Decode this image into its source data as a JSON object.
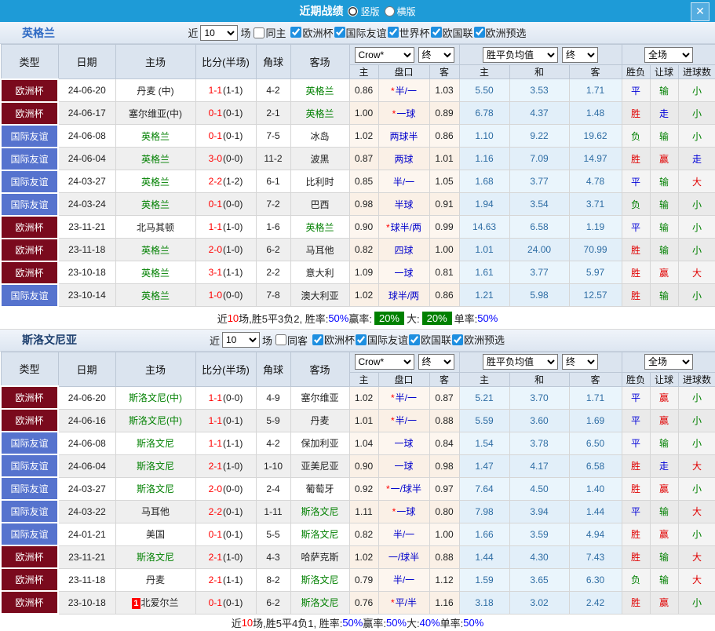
{
  "titlebar": {
    "title": "近期战绩",
    "radio_vertical": "竖版",
    "radio_horizontal": "横版",
    "close": "✕"
  },
  "filter_labels": {
    "near": "近",
    "count": "10",
    "games": "场"
  },
  "headers": {
    "type": "类型",
    "date": "日期",
    "home": "主场",
    "score": "比分(半场)",
    "corner": "角球",
    "away": "客场",
    "sub": [
      "主",
      "盘口",
      "客",
      "主",
      "和",
      "客",
      "胜负",
      "让球",
      "进球数"
    ],
    "dd_crow": "Crow*",
    "dd_final": "终",
    "dd_avg": "胜平负均值",
    "dd_full": "全场"
  },
  "league_colors": {
    "欧洲杯": "#7a0a1d",
    "国际友谊": "#5673ce"
  },
  "value_colors": {
    "胜": "#e00000",
    "平": "#0000d8",
    "负": "#008000",
    "赢": "#e00000",
    "走": "#0000d8",
    "输": "#008000",
    "大": "#e00000",
    "小": "#008000"
  },
  "colors": {
    "topbar": "#1e9bd7",
    "score": "#ff0000",
    "self_team": "#008000",
    "handicap": "#0000cc",
    "avg_text": "#2e6da4",
    "badge_bg": "#008000"
  },
  "sections": [
    {
      "team": "英格兰",
      "focal": "英格兰",
      "label_color": "#2e6ac4",
      "count": "10",
      "same_label": "同主",
      "leagues": [
        "欧洲杯",
        "国际友谊",
        "世界杯",
        "欧国联",
        "欧洲预选"
      ],
      "rows": [
        {
          "lg": "欧洲杯",
          "d": "24-06-20",
          "h": "丹麦 (中)",
          "ft": "1-1",
          "ht": "1-1",
          "c": "4-2",
          "a": "英格兰",
          "o1": "0.86",
          "st": true,
          "pk": "半/一",
          "o2": "1.03",
          "m1": "5.50",
          "m2": "3.53",
          "m3": "1.71",
          "r": "平",
          "l": "输",
          "g": "小"
        },
        {
          "lg": "欧洲杯",
          "d": "24-06-17",
          "h": "塞尔维亚(中)",
          "ft": "0-1",
          "ht": "0-1",
          "c": "2-1",
          "a": "英格兰",
          "o1": "1.00",
          "st": true,
          "pk": "一球",
          "o2": "0.89",
          "m1": "6.78",
          "m2": "4.37",
          "m3": "1.48",
          "r": "胜",
          "l": "走",
          "g": "小"
        },
        {
          "lg": "国际友谊",
          "d": "24-06-08",
          "h": "英格兰",
          "ft": "0-1",
          "ht": "0-1",
          "c": "7-5",
          "a": "冰岛",
          "o1": "1.02",
          "st": false,
          "pk": "两球半",
          "o2": "0.86",
          "m1": "1.10",
          "m2": "9.22",
          "m3": "19.62",
          "r": "负",
          "l": "输",
          "g": "小"
        },
        {
          "lg": "国际友谊",
          "d": "24-06-04",
          "h": "英格兰",
          "ft": "3-0",
          "ht": "0-0",
          "c": "11-2",
          "a": "波黑",
          "o1": "0.87",
          "st": false,
          "pk": "两球",
          "o2": "1.01",
          "m1": "1.16",
          "m2": "7.09",
          "m3": "14.97",
          "r": "胜",
          "l": "赢",
          "g": "走"
        },
        {
          "lg": "国际友谊",
          "d": "24-03-27",
          "h": "英格兰",
          "ft": "2-2",
          "ht": "1-2",
          "c": "6-1",
          "a": "比利时",
          "o1": "0.85",
          "st": false,
          "pk": "半/一",
          "o2": "1.05",
          "m1": "1.68",
          "m2": "3.77",
          "m3": "4.78",
          "r": "平",
          "l": "输",
          "g": "大"
        },
        {
          "lg": "国际友谊",
          "d": "24-03-24",
          "h": "英格兰",
          "ft": "0-1",
          "ht": "0-0",
          "c": "7-2",
          "a": "巴西",
          "o1": "0.98",
          "st": false,
          "pk": "半球",
          "o2": "0.91",
          "m1": "1.94",
          "m2": "3.54",
          "m3": "3.71",
          "r": "负",
          "l": "输",
          "g": "小"
        },
        {
          "lg": "欧洲杯",
          "d": "23-11-21",
          "h": "北马其顿",
          "ft": "1-1",
          "ht": "1-0",
          "c": "1-6",
          "a": "英格兰",
          "o1": "0.90",
          "st": true,
          "pk": "球半/两",
          "o2": "0.99",
          "m1": "14.63",
          "m2": "6.58",
          "m3": "1.19",
          "r": "平",
          "l": "输",
          "g": "小"
        },
        {
          "lg": "欧洲杯",
          "d": "23-11-18",
          "h": "英格兰",
          "ft": "2-0",
          "ht": "1-0",
          "c": "6-2",
          "a": "马耳他",
          "o1": "0.82",
          "st": false,
          "pk": "四球",
          "o2": "1.00",
          "m1": "1.01",
          "m2": "24.00",
          "m3": "70.99",
          "r": "胜",
          "l": "输",
          "g": "小"
        },
        {
          "lg": "欧洲杯",
          "d": "23-10-18",
          "h": "英格兰",
          "ft": "3-1",
          "ht": "1-1",
          "c": "2-2",
          "a": "意大利",
          "o1": "1.09",
          "st": false,
          "pk": "一球",
          "o2": "0.81",
          "m1": "1.61",
          "m2": "3.77",
          "m3": "5.97",
          "r": "胜",
          "l": "赢",
          "g": "大"
        },
        {
          "lg": "国际友谊",
          "d": "23-10-14",
          "h": "英格兰",
          "ft": "1-0",
          "ht": "0-0",
          "c": "7-8",
          "a": "澳大利亚",
          "o1": "1.02",
          "st": false,
          "pk": "球半/两",
          "o2": "0.86",
          "m1": "1.21",
          "m2": "5.98",
          "m3": "12.57",
          "r": "胜",
          "l": "输",
          "g": "小"
        }
      ],
      "summary": [
        {
          "t": "近"
        },
        {
          "t": "10",
          "c": "red"
        },
        {
          "t": "场,胜5平3负2, 胜率:"
        },
        {
          "t": "50%",
          "c": "blue"
        },
        {
          "t": " 赢率:"
        },
        {
          "t": "20%",
          "c": "badge"
        },
        {
          "t": " 大:"
        },
        {
          "t": "20%",
          "c": "badge"
        },
        {
          "t": " 单率:"
        },
        {
          "t": "50%",
          "c": "blue"
        }
      ],
      "compact": false
    },
    {
      "team": "斯洛文尼亚",
      "focal": "斯洛文尼",
      "label_color": "#1d3f6e",
      "count": "10",
      "same_label": "同客",
      "leagues": [
        "欧洲杯",
        "国际友谊",
        "欧国联",
        "欧洲预选"
      ],
      "rows": [
        {
          "lg": "欧洲杯",
          "d": "24-06-20",
          "h": "斯洛文尼(中)",
          "ft": "1-1",
          "ht": "0-0",
          "c": "4-9",
          "a": "塞尔维亚",
          "o1": "1.02",
          "st": true,
          "pk": "半/一",
          "o2": "0.87",
          "m1": "5.21",
          "m2": "3.70",
          "m3": "1.71",
          "r": "平",
          "l": "赢",
          "g": "小"
        },
        {
          "lg": "欧洲杯",
          "d": "24-06-16",
          "h": "斯洛文尼(中)",
          "ft": "1-1",
          "ht": "0-1",
          "c": "5-9",
          "a": "丹麦",
          "o1": "1.01",
          "st": true,
          "pk": "半/一",
          "o2": "0.88",
          "m1": "5.59",
          "m2": "3.60",
          "m3": "1.69",
          "r": "平",
          "l": "赢",
          "g": "小"
        },
        {
          "lg": "国际友谊",
          "d": "24-06-08",
          "h": "斯洛文尼",
          "ft": "1-1",
          "ht": "1-1",
          "c": "4-2",
          "a": "保加利亚",
          "o1": "1.04",
          "st": false,
          "pk": "一球",
          "o2": "0.84",
          "m1": "1.54",
          "m2": "3.78",
          "m3": "6.50",
          "r": "平",
          "l": "输",
          "g": "小"
        },
        {
          "lg": "国际友谊",
          "d": "24-06-04",
          "h": "斯洛文尼",
          "ft": "2-1",
          "ht": "1-0",
          "c": "1-10",
          "a": "亚美尼亚",
          "o1": "0.90",
          "st": false,
          "pk": "一球",
          "o2": "0.98",
          "m1": "1.47",
          "m2": "4.17",
          "m3": "6.58",
          "r": "胜",
          "l": "走",
          "g": "大"
        },
        {
          "lg": "国际友谊",
          "d": "24-03-27",
          "h": "斯洛文尼",
          "ft": "2-0",
          "ht": "0-0",
          "c": "2-4",
          "a": "葡萄牙",
          "o1": "0.92",
          "st": true,
          "pk": "一/球半",
          "o2": "0.97",
          "m1": "7.64",
          "m2": "4.50",
          "m3": "1.40",
          "r": "胜",
          "l": "赢",
          "g": "小"
        },
        {
          "lg": "国际友谊",
          "d": "24-03-22",
          "h": "马耳他",
          "ft": "2-2",
          "ht": "0-1",
          "c": "1-11",
          "a": "斯洛文尼",
          "o1": "1.11",
          "st": true,
          "pk": "一球",
          "o2": "0.80",
          "m1": "7.98",
          "m2": "3.94",
          "m3": "1.44",
          "r": "平",
          "l": "输",
          "g": "大"
        },
        {
          "lg": "国际友谊",
          "d": "24-01-21",
          "h": "美国",
          "ft": "0-1",
          "ht": "0-1",
          "c": "5-5",
          "a": "斯洛文尼",
          "o1": "0.82",
          "st": false,
          "pk": "半/一",
          "o2": "1.00",
          "m1": "1.66",
          "m2": "3.59",
          "m3": "4.94",
          "r": "胜",
          "l": "赢",
          "g": "小"
        },
        {
          "lg": "欧洲杯",
          "d": "23-11-21",
          "h": "斯洛文尼",
          "ft": "2-1",
          "ht": "1-0",
          "c": "4-3",
          "a": "哈萨克斯",
          "o1": "1.02",
          "st": false,
          "pk": "一/球半",
          "o2": "0.88",
          "m1": "1.44",
          "m2": "4.30",
          "m3": "7.43",
          "r": "胜",
          "l": "输",
          "g": "大"
        },
        {
          "lg": "欧洲杯",
          "d": "23-11-18",
          "h": "丹麦",
          "ft": "2-1",
          "ht": "1-1",
          "c": "8-2",
          "a": "斯洛文尼",
          "o1": "0.79",
          "st": false,
          "pk": "半/一",
          "o2": "1.12",
          "m1": "1.59",
          "m2": "3.65",
          "m3": "6.30",
          "r": "负",
          "l": "输",
          "g": "大"
        },
        {
          "lg": "欧洲杯",
          "d": "23-10-18",
          "h": "北爱尔兰",
          "rc": "1",
          "ft": "0-1",
          "ht": "0-1",
          "c": "6-2",
          "a": "斯洛文尼",
          "o1": "0.76",
          "st": true,
          "pk": "平/半",
          "o2": "1.16",
          "m1": "3.18",
          "m2": "3.02",
          "m3": "2.42",
          "r": "胜",
          "l": "赢",
          "g": "小"
        }
      ],
      "summary": [
        {
          "t": "近"
        },
        {
          "t": "10",
          "c": "red"
        },
        {
          "t": "场,胜5平4负1, 胜率:"
        },
        {
          "t": "50%",
          "c": "blue"
        },
        {
          "t": " 赢率:"
        },
        {
          "t": "50%",
          "c": "blue"
        },
        {
          "t": " 大:"
        },
        {
          "t": "40%",
          "c": "blue"
        },
        {
          "t": " 单率:"
        },
        {
          "t": "50%",
          "c": "blue"
        }
      ],
      "compact": true
    }
  ]
}
